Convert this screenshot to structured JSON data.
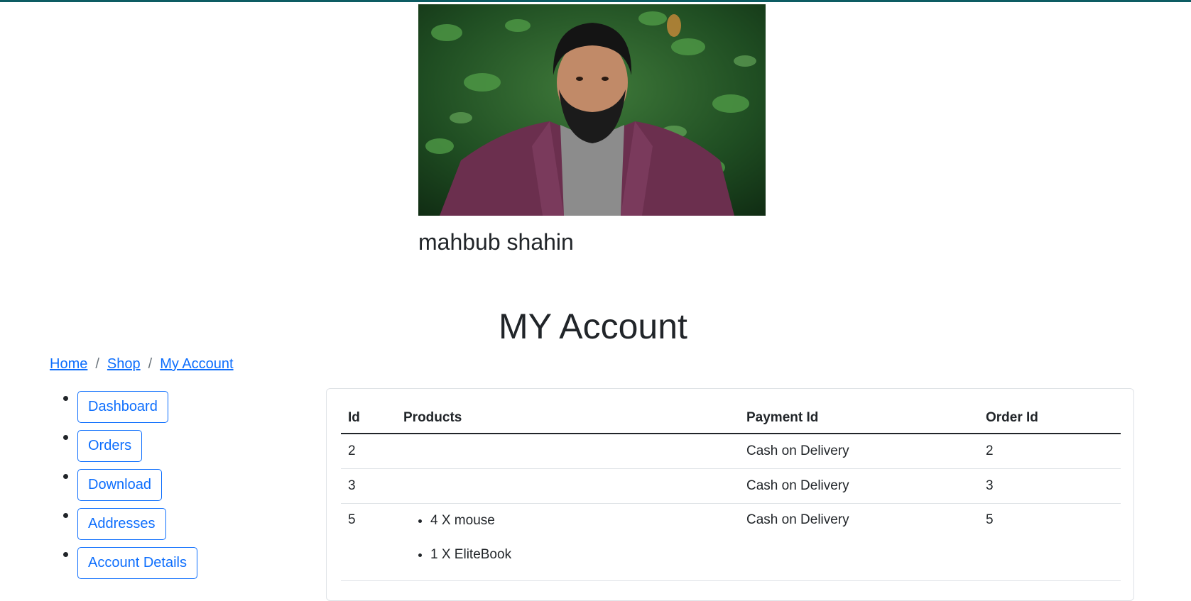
{
  "profile": {
    "name": "mahbub shahin",
    "photo_alt": "profile photo"
  },
  "page": {
    "title": "MY Account"
  },
  "breadcrumb": {
    "items": [
      "Home",
      "Shop",
      "My Account"
    ],
    "separator": "/"
  },
  "side_nav": {
    "items": [
      "Dashboard",
      "Orders",
      "Download",
      "Addresses",
      "Account Details"
    ]
  },
  "orders_table": {
    "headers": [
      "Id",
      "Products",
      "Payment Id",
      "Order Id"
    ],
    "rows": [
      {
        "id": "2",
        "products": [],
        "payment_id": "Cash on Delivery",
        "order_id": "2"
      },
      {
        "id": "3",
        "products": [],
        "payment_id": "Cash on Delivery",
        "order_id": "3"
      },
      {
        "id": "5",
        "products": [
          "4 X mouse",
          "1 X EliteBook"
        ],
        "payment_id": "Cash on Delivery",
        "order_id": "5"
      }
    ]
  },
  "colors": {
    "accent": "#0d6efd",
    "top_bar": "#0d5c63",
    "text": "#212529"
  }
}
